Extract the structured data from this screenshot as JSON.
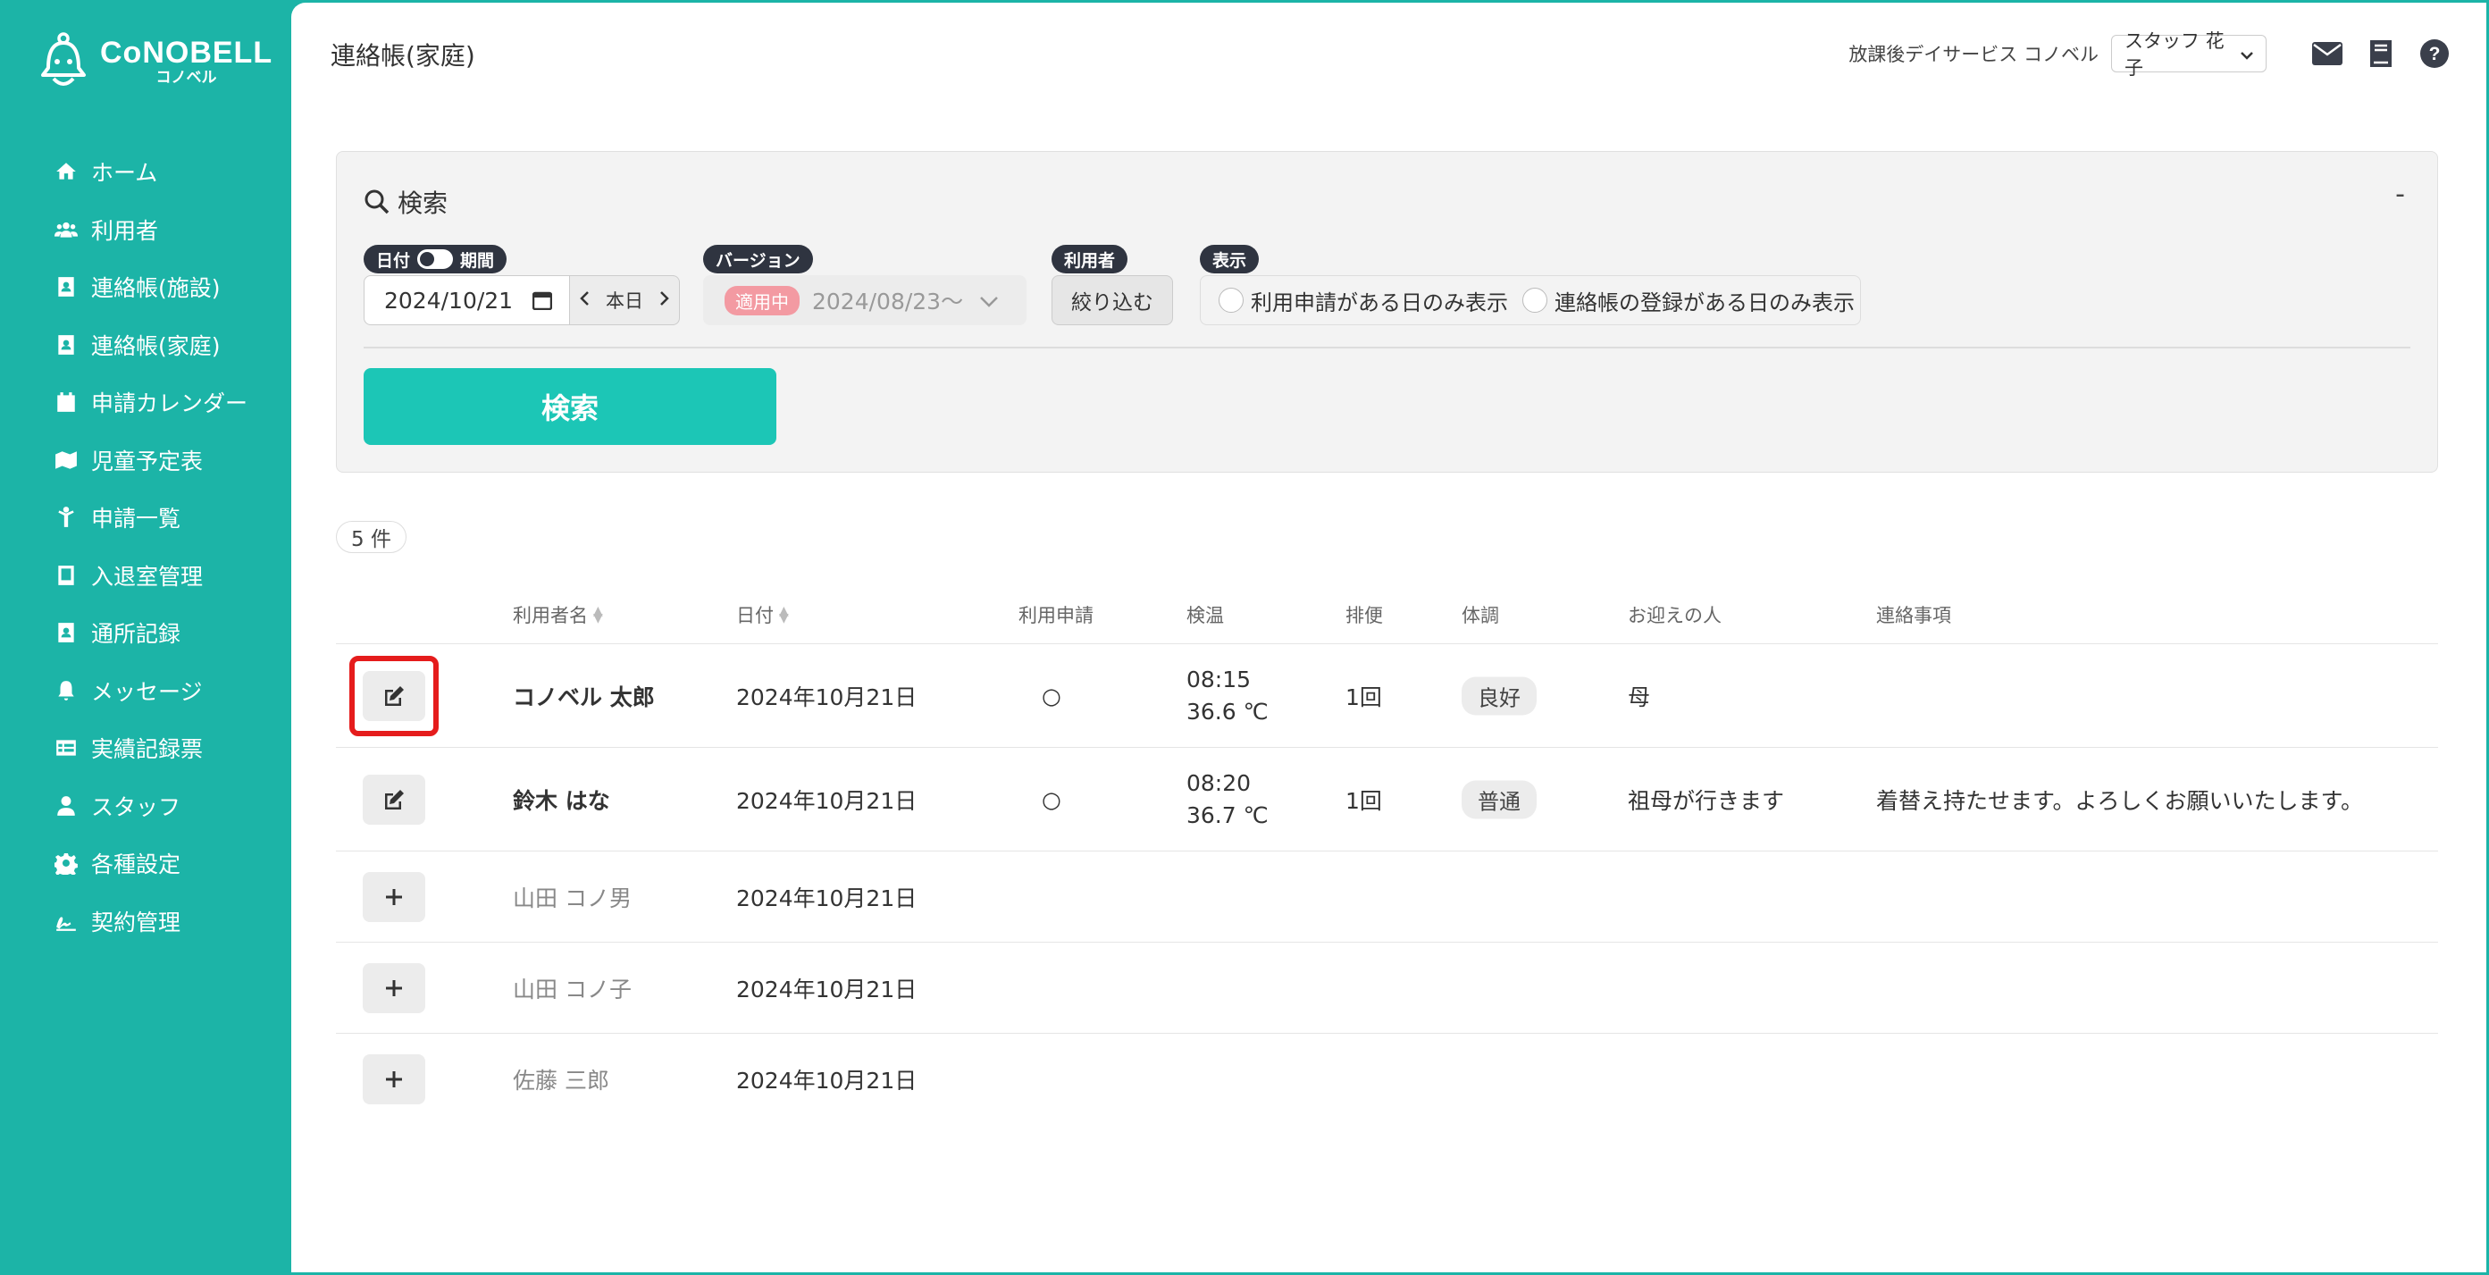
{
  "brand": {
    "name": "CoNOBELL",
    "sub": "コノベル"
  },
  "sidebar": {
    "items": [
      {
        "label": "ホーム",
        "icon": "home-icon"
      },
      {
        "label": "利用者",
        "icon": "users-icon"
      },
      {
        "label": "連絡帳(施設)",
        "icon": "contact-book-icon"
      },
      {
        "label": "連絡帳(家庭)",
        "icon": "contact-book-icon"
      },
      {
        "label": "申請カレンダー",
        "icon": "calendar-icon"
      },
      {
        "label": "児童予定表",
        "icon": "map-icon"
      },
      {
        "label": "申請一覧",
        "icon": "child-icon"
      },
      {
        "label": "入退室管理",
        "icon": "tablet-icon"
      },
      {
        "label": "通所記録",
        "icon": "contact-book-icon"
      },
      {
        "label": "メッセージ",
        "icon": "bell-icon"
      },
      {
        "label": "実績記録票",
        "icon": "table-icon"
      },
      {
        "label": "スタッフ",
        "icon": "staff-icon"
      },
      {
        "label": "各種設定",
        "icon": "gear-icon"
      },
      {
        "label": "契約管理",
        "icon": "signature-icon"
      }
    ]
  },
  "header": {
    "title": "連絡帳(家庭)",
    "facility": "放課後デイサービス コノベル",
    "staff_selected": "スタッフ 花子"
  },
  "search": {
    "title": "検索",
    "collapse": "-",
    "date_tag_left": "日付",
    "date_tag_right": "期間",
    "date_value": "2024/10/21",
    "today_label": "本日",
    "version_tag": "バージョン",
    "version_active": "適用中",
    "version_value": "2024/08/23〜",
    "user_tag": "利用者",
    "narrow_label": "絞り込む",
    "display_tag": "表示",
    "option1": "利用申請がある日のみ表示",
    "option2": "連絡帳の登録がある日のみ表示",
    "button": "検索"
  },
  "count": "5 件",
  "table": {
    "headers": {
      "name": "利用者名",
      "date": "日付",
      "application": "利用申請",
      "temp": "検温",
      "bowel": "排便",
      "condition": "体調",
      "pickup": "お迎えの人",
      "notes": "連絡事項"
    },
    "rows": [
      {
        "name": "コノベル 太郎",
        "date": "2024年10月21日",
        "application": "○",
        "time": "08:15",
        "temp": "36.6 ℃",
        "bowel": "1回",
        "condition": "良好",
        "pickup": "母",
        "notes": ""
      },
      {
        "name": "鈴木 はな",
        "date": "2024年10月21日",
        "application": "○",
        "time": "08:20",
        "temp": "36.7 ℃",
        "bowel": "1回",
        "condition": "普通",
        "pickup": "祖母が行きます",
        "notes": "着替え持たせます。よろしくお願いいたします。"
      },
      {
        "name": "山田 コノ男",
        "date": "2024年10月21日"
      },
      {
        "name": "山田 コノ子",
        "date": "2024年10月21日"
      },
      {
        "name": "佐藤 三郎",
        "date": "2024年10月21日"
      }
    ]
  },
  "colors": {
    "brand": "#1cb4a7",
    "button": "#1cc6b6",
    "highlight": "#e51c1c",
    "active_badge": "#f39aa2"
  }
}
